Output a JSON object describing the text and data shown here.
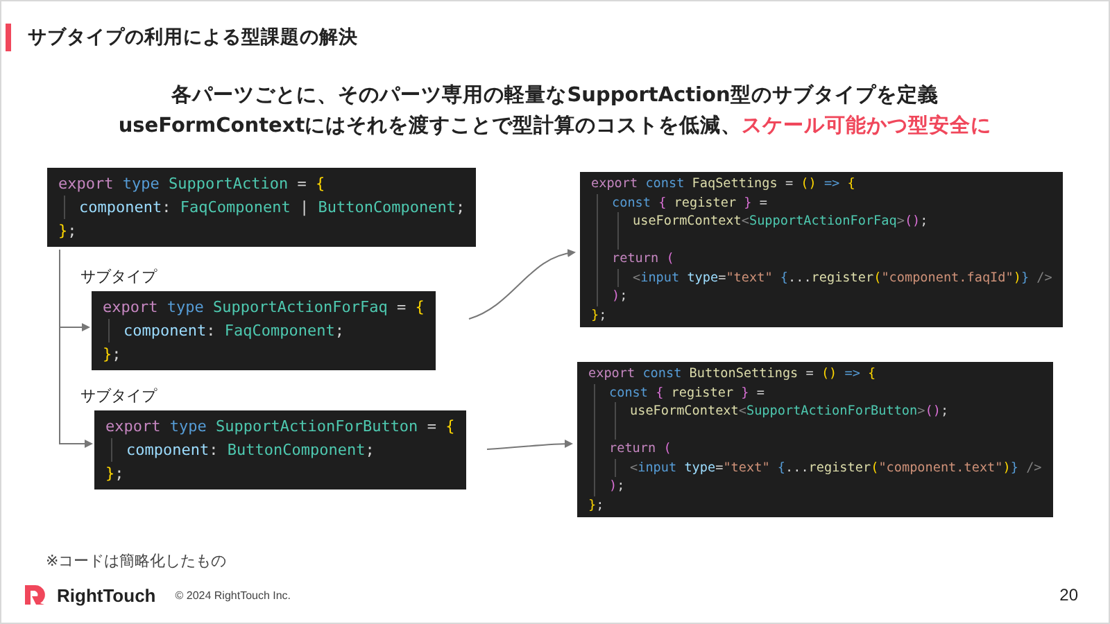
{
  "header": {
    "title": "サブタイプの利用による型課題の解決"
  },
  "lead": {
    "lines": [
      "各パーツごとに、そのパーツ専用の軽量なSupportAction型のサブタイプを定義",
      "useFormContextにはそれを渡すことで型計算のコストを低減、**スケール可能かつ型安全に**"
    ]
  },
  "base_type": {
    "lines": [
      {
        "tokens": [
          {
            "kind": "keyword",
            "text": "export "
          },
          {
            "kind": "storage",
            "text": "type "
          },
          {
            "kind": "type",
            "text": "SupportAction "
          },
          {
            "kind": "punct",
            "text": "= "
          },
          {
            "kind": "brace",
            "text": "{"
          }
        ],
        "children": [
          {
            "tokens": [
              {
                "kind": "prop",
                "text": "component"
              },
              {
                "kind": "punct",
                "text": ": "
              },
              {
                "kind": "type",
                "text": "FaqComponent "
              },
              {
                "kind": "punct",
                "text": "| "
              },
              {
                "kind": "type",
                "text": "ButtonComponent"
              },
              {
                "kind": "punct",
                "text": ";"
              }
            ]
          }
        ]
      },
      {
        "tokens": [
          {
            "kind": "brace",
            "text": "}"
          },
          {
            "kind": "punct",
            "text": ";"
          }
        ]
      }
    ]
  },
  "subtypes": [
    {
      "label": "サブタイプ",
      "lines": [
        {
          "tokens": [
            {
              "kind": "keyword",
              "text": "export "
            },
            {
              "kind": "storage",
              "text": "type "
            },
            {
              "kind": "type",
              "text": "SupportActionForFaq "
            },
            {
              "kind": "punct",
              "text": "= "
            },
            {
              "kind": "brace",
              "text": "{"
            }
          ],
          "children": [
            {
              "tokens": [
                {
                  "kind": "prop",
                  "text": "component"
                },
                {
                  "kind": "punct",
                  "text": ": "
                },
                {
                  "kind": "type",
                  "text": "FaqComponent"
                },
                {
                  "kind": "punct",
                  "text": ";"
                }
              ]
            }
          ]
        },
        {
          "tokens": [
            {
              "kind": "brace",
              "text": "}"
            },
            {
              "kind": "punct",
              "text": ";"
            }
          ]
        }
      ]
    },
    {
      "label": "サブタイプ",
      "lines": [
        {
          "tokens": [
            {
              "kind": "keyword",
              "text": "export "
            },
            {
              "kind": "storage",
              "text": "type "
            },
            {
              "kind": "type",
              "text": "SupportActionForButton "
            },
            {
              "kind": "punct",
              "text": "= "
            },
            {
              "kind": "brace",
              "text": "{"
            }
          ],
          "children": [
            {
              "tokens": [
                {
                  "kind": "prop",
                  "text": "component"
                },
                {
                  "kind": "punct",
                  "text": ": "
                },
                {
                  "kind": "type",
                  "text": "ButtonComponent"
                },
                {
                  "kind": "punct",
                  "text": ";"
                }
              ]
            }
          ]
        },
        {
          "tokens": [
            {
              "kind": "brace",
              "text": "}"
            },
            {
              "kind": "punct",
              "text": ";"
            }
          ]
        }
      ]
    }
  ],
  "components": [
    {
      "lines": [
        {
          "tokens": [
            {
              "kind": "keyword",
              "text": "export "
            },
            {
              "kind": "storage",
              "text": "const "
            },
            {
              "kind": "func",
              "text": "FaqSettings "
            },
            {
              "kind": "punct",
              "text": "= "
            },
            {
              "kind": "brace",
              "text": "() "
            },
            {
              "kind": "storage",
              "text": "=> "
            },
            {
              "kind": "brace",
              "text": "{"
            }
          ],
          "children": [
            {
              "tokens": [
                {
                  "kind": "storage",
                  "text": "const "
                },
                {
                  "kind": "bracket",
                  "text": "{ "
                },
                {
                  "kind": "func",
                  "text": "register "
                },
                {
                  "kind": "bracket",
                  "text": "} "
                },
                {
                  "kind": "punct",
                  "text": "="
                }
              ],
              "children": [
                {
                  "tokens": [
                    {
                      "kind": "func",
                      "text": "useFormContext"
                    },
                    {
                      "kind": "tag",
                      "text": "<"
                    },
                    {
                      "kind": "type",
                      "text": "SupportActionForFaq"
                    },
                    {
                      "kind": "tag",
                      "text": ">"
                    },
                    {
                      "kind": "bracket",
                      "text": "()"
                    },
                    {
                      "kind": "punct",
                      "text": ";"
                    }
                  ]
                }
              ]
            },
            {
              "tokens": [
                {
                  "kind": "keyword",
                  "text": "return "
                },
                {
                  "kind": "bracket",
                  "text": "("
                }
              ],
              "children": [
                {
                  "tokens": [
                    {
                      "kind": "tag",
                      "text": "<"
                    },
                    {
                      "kind": "storage",
                      "text": "input "
                    },
                    {
                      "kind": "prop",
                      "text": "type"
                    },
                    {
                      "kind": "punct",
                      "text": "="
                    },
                    {
                      "kind": "string",
                      "text": "\"text\" "
                    },
                    {
                      "kind": "storage",
                      "text": "{"
                    },
                    {
                      "kind": "punct",
                      "text": "..."
                    },
                    {
                      "kind": "func",
                      "text": "register"
                    },
                    {
                      "kind": "brace",
                      "text": "("
                    },
                    {
                      "kind": "string",
                      "text": "\"component.faqId\""
                    },
                    {
                      "kind": "brace",
                      "text": ")"
                    },
                    {
                      "kind": "storage",
                      "text": "} "
                    },
                    {
                      "kind": "tag",
                      "text": "/>"
                    }
                  ]
                }
              ]
            },
            {
              "tokens": [
                {
                  "kind": "bracket",
                  "text": ")"
                },
                {
                  "kind": "punct",
                  "text": ";"
                }
              ]
            }
          ]
        },
        {
          "tokens": [
            {
              "kind": "brace",
              "text": "}"
            },
            {
              "kind": "punct",
              "text": ";"
            }
          ]
        }
      ]
    },
    {
      "lines": [
        {
          "tokens": [
            {
              "kind": "keyword",
              "text": "export "
            },
            {
              "kind": "storage",
              "text": "const "
            },
            {
              "kind": "func",
              "text": "ButtonSettings "
            },
            {
              "kind": "punct",
              "text": "= "
            },
            {
              "kind": "brace",
              "text": "() "
            },
            {
              "kind": "storage",
              "text": "=> "
            },
            {
              "kind": "brace",
              "text": "{"
            }
          ],
          "children": [
            {
              "tokens": [
                {
                  "kind": "storage",
                  "text": "const "
                },
                {
                  "kind": "bracket",
                  "text": "{ "
                },
                {
                  "kind": "func",
                  "text": "register "
                },
                {
                  "kind": "bracket",
                  "text": "} "
                },
                {
                  "kind": "punct",
                  "text": "="
                }
              ],
              "children": [
                {
                  "tokens": [
                    {
                      "kind": "func",
                      "text": "useFormContext"
                    },
                    {
                      "kind": "tag",
                      "text": "<"
                    },
                    {
                      "kind": "type",
                      "text": "SupportActionForButton"
                    },
                    {
                      "kind": "tag",
                      "text": ">"
                    },
                    {
                      "kind": "bracket",
                      "text": "()"
                    },
                    {
                      "kind": "punct",
                      "text": ";"
                    }
                  ]
                }
              ]
            },
            {
              "tokens": [
                {
                  "kind": "keyword",
                  "text": "return "
                },
                {
                  "kind": "bracket",
                  "text": "("
                }
              ],
              "children": [
                {
                  "tokens": [
                    {
                      "kind": "tag",
                      "text": "<"
                    },
                    {
                      "kind": "storage",
                      "text": "input "
                    },
                    {
                      "kind": "prop",
                      "text": "type"
                    },
                    {
                      "kind": "punct",
                      "text": "="
                    },
                    {
                      "kind": "string",
                      "text": "\"text\" "
                    },
                    {
                      "kind": "storage",
                      "text": "{"
                    },
                    {
                      "kind": "punct",
                      "text": "..."
                    },
                    {
                      "kind": "func",
                      "text": "register"
                    },
                    {
                      "kind": "brace",
                      "text": "("
                    },
                    {
                      "kind": "string",
                      "text": "\"component.text\""
                    },
                    {
                      "kind": "brace",
                      "text": ")"
                    },
                    {
                      "kind": "storage",
                      "text": "} "
                    },
                    {
                      "kind": "tag",
                      "text": "/>"
                    }
                  ]
                }
              ]
            },
            {
              "tokens": [
                {
                  "kind": "bracket",
                  "text": ")"
                },
                {
                  "kind": "punct",
                  "text": ";"
                }
              ]
            }
          ]
        },
        {
          "tokens": [
            {
              "kind": "brace",
              "text": "}"
            },
            {
              "kind": "punct",
              "text": ";"
            }
          ]
        }
      ]
    }
  ],
  "footnote": "※コードは簡略化したもの",
  "footer": {
    "brand": "RightTouch",
    "copyright": "© 2024 RightTouch Inc.",
    "page_number": "20"
  }
}
